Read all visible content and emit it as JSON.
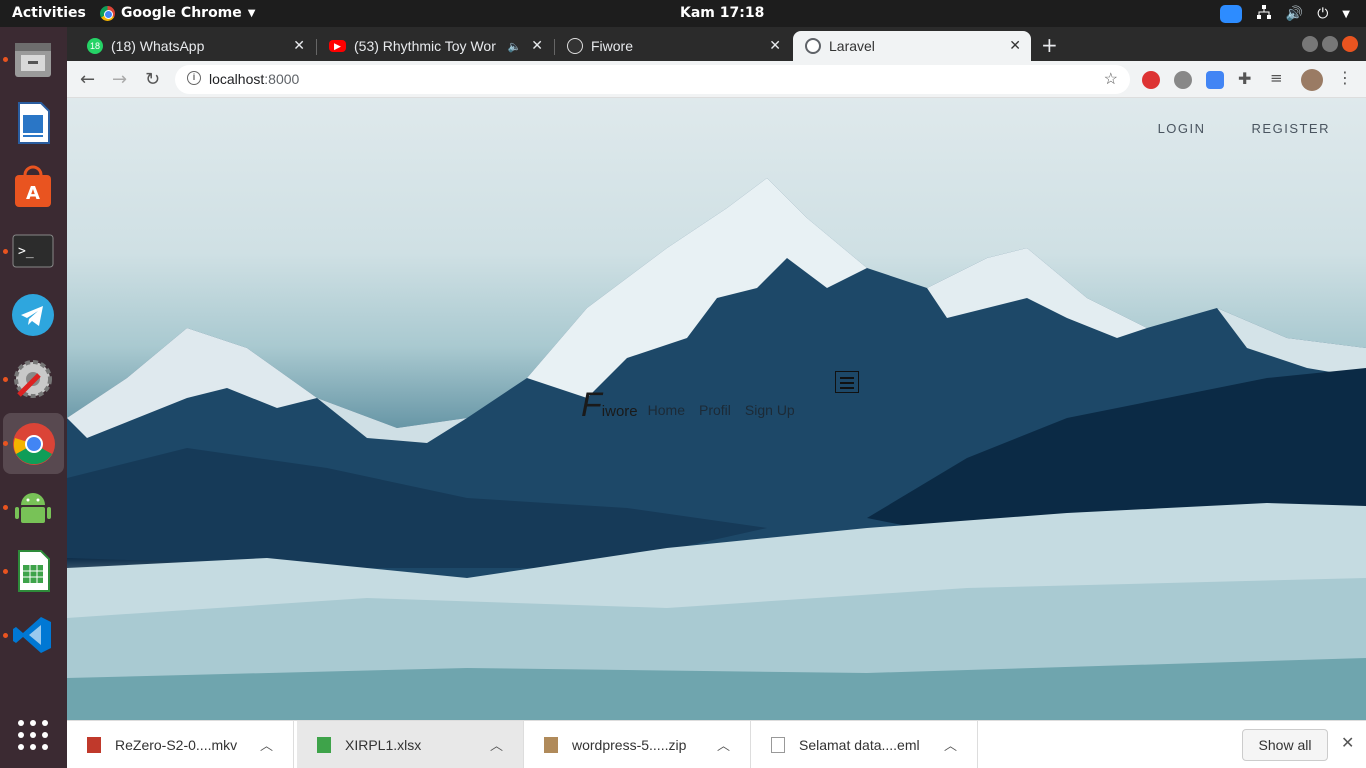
{
  "topbar": {
    "activities": "Activities",
    "app_name": "Google Chrome",
    "clock": "Kam 17:18"
  },
  "tabs": [
    {
      "label": "(18) WhatsApp",
      "badge": "18",
      "favicon_color": "#25d366"
    },
    {
      "label": "(53) Rhythmic Toy Wor",
      "favicon_color": "#ff0000"
    },
    {
      "label": "Fiwore",
      "favicon_color": "#333333"
    },
    {
      "label": "Laravel",
      "favicon_color": "#5f6368"
    }
  ],
  "omnibox": {
    "host": "localhost",
    "port": ":8000"
  },
  "page": {
    "login": "LOGIN",
    "register": "REGISTER",
    "brand_f": "F",
    "brand_rest": "iwore",
    "nav": [
      "Home",
      "Profil",
      "Sign Up"
    ]
  },
  "downloads": [
    {
      "name": "ReZero-S2-0....mkv",
      "icon": "video-file-icon"
    },
    {
      "name": "XIRPL1.xlsx",
      "icon": "spreadsheet-file-icon"
    },
    {
      "name": "wordpress-5.....zip",
      "icon": "archive-file-icon"
    },
    {
      "name": "Selamat data....eml",
      "icon": "document-file-icon"
    }
  ],
  "show_all": "Show all",
  "colors": {
    "accent": "#e95420",
    "dock_bg": "#3b2a32"
  }
}
